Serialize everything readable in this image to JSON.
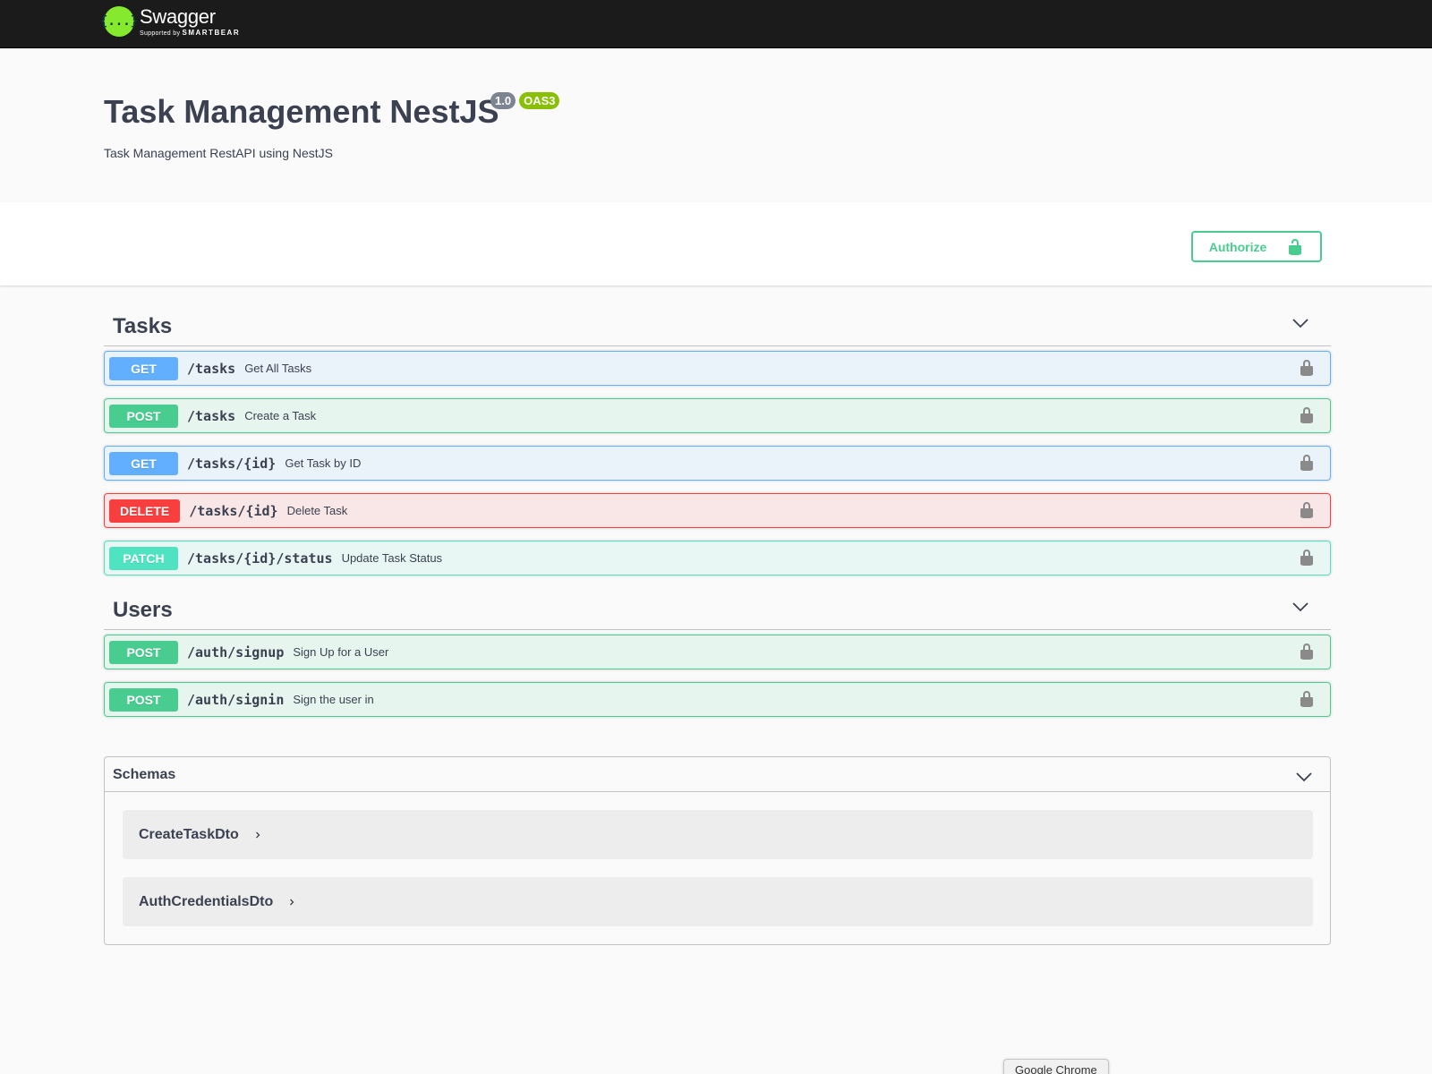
{
  "topbar": {
    "logo_symbol": "{...}",
    "logo_name": "Swagger",
    "logo_sub_prefix": "Supported by",
    "logo_sub_brand": "SMARTBEAR",
    "logo_color": "#85ea2d"
  },
  "info": {
    "title": "Task Management NestJS",
    "version": "1.0",
    "oas": "OAS3",
    "description": "Task Management RestAPI using NestJS"
  },
  "authorize": {
    "label": "Authorize",
    "icon": "unlock-icon",
    "color": "#49cc90"
  },
  "tags": [
    {
      "name": "Tasks",
      "operations": [
        {
          "method": "GET",
          "path": "/tasks",
          "summary": "Get All Tasks"
        },
        {
          "method": "POST",
          "path": "/tasks",
          "summary": "Create a Task"
        },
        {
          "method": "GET",
          "path": "/tasks/{id}",
          "summary": "Get Task by ID"
        },
        {
          "method": "DELETE",
          "path": "/tasks/{id}",
          "summary": "Delete Task"
        },
        {
          "method": "PATCH",
          "path": "/tasks/{id}/status",
          "summary": "Update Task Status"
        }
      ]
    },
    {
      "name": "Users",
      "operations": [
        {
          "method": "POST",
          "path": "/auth/signup",
          "summary": "Sign Up for a User"
        },
        {
          "method": "POST",
          "path": "/auth/signin",
          "summary": "Sign the user in"
        }
      ]
    }
  ],
  "schemas": {
    "title": "Schemas",
    "items": [
      "CreateTaskDto",
      "AuthCredentialsDto"
    ]
  },
  "tooltip": "Google Chrome",
  "method_colors": {
    "GET": "#61affe",
    "POST": "#49cc90",
    "DELETE": "#f93e3e",
    "PATCH": "#50e3c2"
  }
}
